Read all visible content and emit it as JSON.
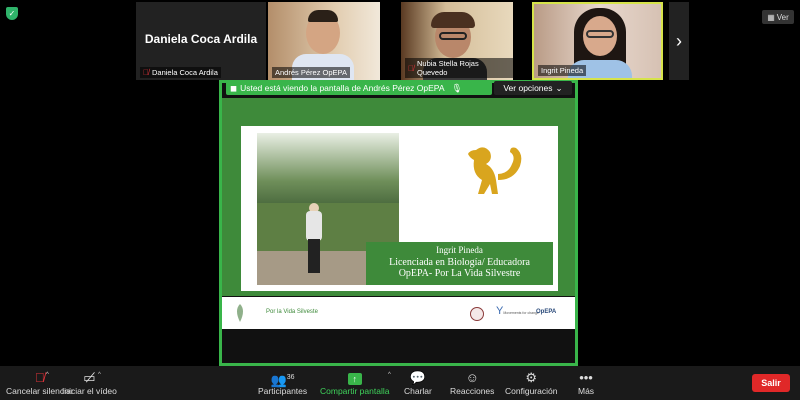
{
  "top": {
    "security_icon": "shield-check-icon",
    "view_button": "Ver"
  },
  "participants": [
    {
      "name": "Daniela Coca Ardila",
      "center_name": "Daniela Coca Ardila",
      "muted": true
    },
    {
      "name": "Andrés Pérez OpEPA",
      "muted": false
    },
    {
      "name": "Nubia Stella Rojas Quevedo",
      "muted": true
    },
    {
      "name": "Ingrit Pineda",
      "muted": false
    }
  ],
  "share": {
    "banner_text": "Usted está viendo la pantalla de Andrés Pérez OpEPA",
    "options_label": "Ver opciones"
  },
  "slide": {
    "caption_name": "Ingrit Pineda",
    "caption_line1": "Licenciada en Biología/ Educadora",
    "caption_line2": "OpEPA- Por La Vida Silvestre",
    "footer_text": "Por la Vida Silveste",
    "logo_text": "OpEPA",
    "logo2_text": "Movements for change"
  },
  "toolbar": {
    "mute_label": "Cancelar silenciar",
    "video_label": "Iniciar el vídeo",
    "participants_label": "Participantes",
    "participants_count": "36",
    "share_label": "Compartir pantalla",
    "chat_label": "Charlar",
    "reactions_label": "Reacciones",
    "settings_label": "Configuración",
    "more_label": "Más",
    "exit_label": "Salir"
  },
  "colors": {
    "accent_green": "#39b54a",
    "slide_green": "#3e8a3a",
    "exit_red": "#e02828",
    "monkey_gold": "#d9a51e"
  }
}
